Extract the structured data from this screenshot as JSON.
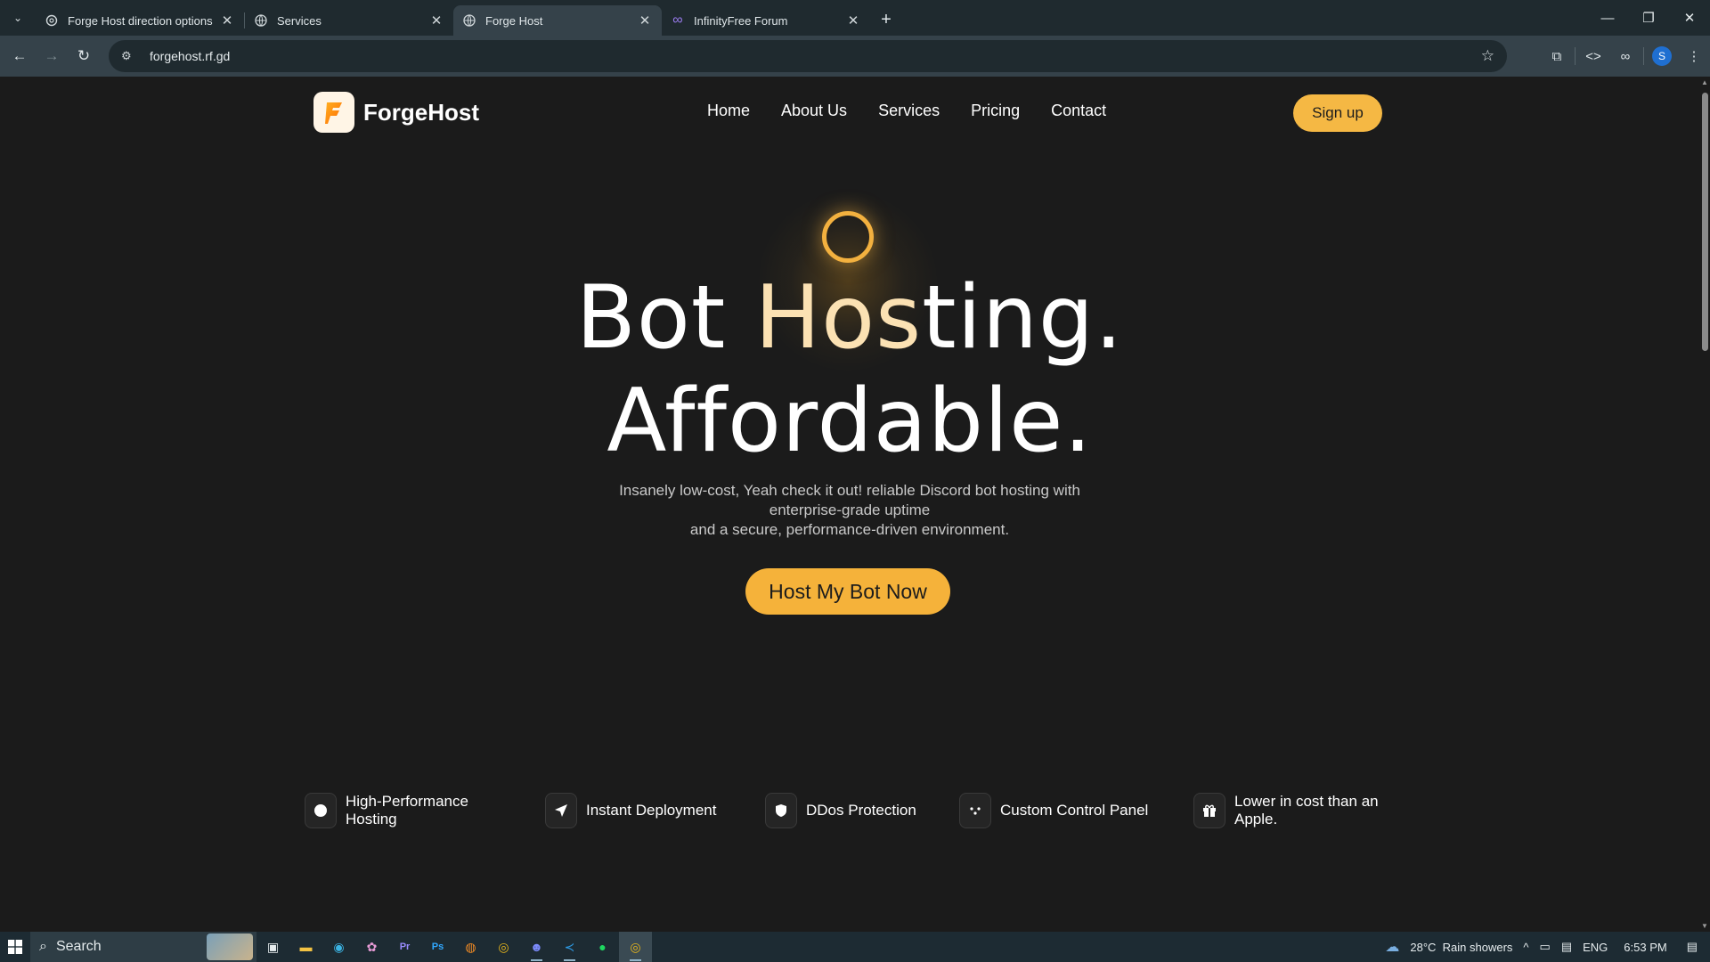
{
  "browser": {
    "tabs": [
      {
        "title": "Forge Host direction options",
        "favicon": "openai-icon",
        "active": false
      },
      {
        "title": "Services",
        "favicon": "globe-icon",
        "active": false
      },
      {
        "title": "Forge Host",
        "favicon": "globe-icon",
        "active": true
      },
      {
        "title": "InfinityFree Forum",
        "favicon": "infinity-icon",
        "active": false
      }
    ],
    "url": "forgehost.rf.gd",
    "profile_initial": "S"
  },
  "site": {
    "brand": "ForgeHost",
    "nav": [
      "Home",
      "About Us",
      "Services",
      "Pricing",
      "Contact"
    ],
    "signup_label": "Sign up",
    "headline": {
      "line1_part1": "Bot ",
      "line1_accent": "Hos",
      "line1_part2": "ting.",
      "line2": "Affordable."
    },
    "subtext_line1": "Insanely low-cost, Yeah check it out! reliable Discord bot hosting with enterprise-grade uptime",
    "subtext_line2": "and a secure, performance-driven environment.",
    "cta_label": "Host My Bot Now",
    "features": [
      {
        "label": "High-Performance Hosting",
        "icon": "circle-icon"
      },
      {
        "label": "Instant Deployment",
        "icon": "send-icon"
      },
      {
        "label": "DDos Protection",
        "icon": "shield-icon"
      },
      {
        "label": "Custom Control Panel",
        "icon": "dots-icon"
      },
      {
        "label": "Lower in cost than an Apple.",
        "icon": "gift-icon"
      }
    ],
    "accent_color": "#f5b23a"
  },
  "taskbar": {
    "search_placeholder": "Search",
    "weather": "28°C  Rain showers",
    "language": "ENG",
    "time": "6:53 PM"
  }
}
